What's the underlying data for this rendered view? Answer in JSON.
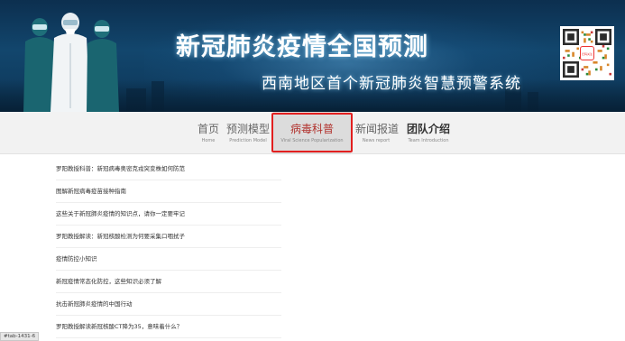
{
  "banner": {
    "title": "新冠肺炎疫情全国预测",
    "subtitle": "西南地区首个新冠肺炎智慧预警系统",
    "qr_label": "扫码关注"
  },
  "nav": {
    "items": [
      {
        "zh": "首页",
        "en": "Home"
      },
      {
        "zh": "预测模型",
        "en": "Prediction Model"
      },
      {
        "zh": "病毒科普",
        "en": "Viral Science Popularization"
      },
      {
        "zh": "新闻报道",
        "en": "News report"
      },
      {
        "zh": "团队介绍",
        "en": "Team Introduction"
      }
    ],
    "active_index": 2
  },
  "articles": [
    "罗阳教授科普：新冠病毒奥密克戎突变株如何防范",
    "图解新冠病毒疫苗接种指南",
    "这些关于新冠肺炎疫情的知识点，请你一定要牢记",
    "罗阳教授解读：新冠核酸检测为何要采集口咽拭子",
    "疫情防控小知识",
    "新冠疫情常态化防控，这些知识必须了解",
    "抗击新冠肺炎疫情的中国行动",
    "罗阳教授解读新冠核酸CT降为35，意味着什么？"
  ],
  "url_hint": "#tab-1431-6",
  "colors": {
    "banner_bg": "#12466d",
    "nav_bg": "#f2f2f2",
    "active_text": "#b1322d",
    "highlight_border": "#e21f1f"
  }
}
